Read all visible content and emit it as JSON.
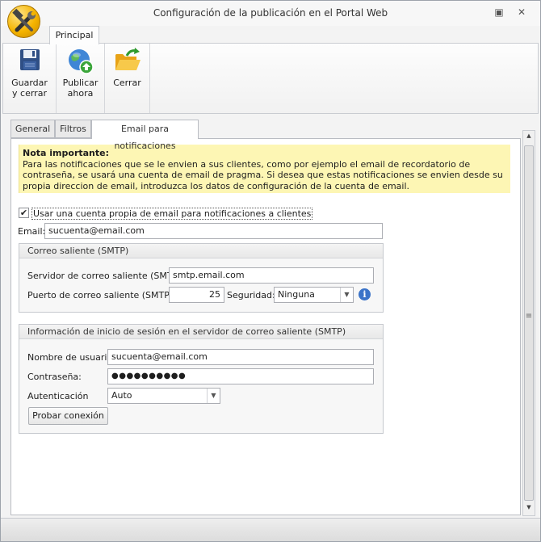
{
  "window": {
    "title": "Configuración de la publicación en el Portal Web",
    "restore_glyph": "▣",
    "close_glyph": "✕"
  },
  "ribbon": {
    "tab_label": "Principal",
    "buttons": [
      {
        "label": "Guardar\ny cerrar",
        "icon": "floppy-disk-icon"
      },
      {
        "label": "Publicar\nahora",
        "icon": "globe-upload-icon"
      },
      {
        "label": "Cerrar",
        "icon": "folder-icon"
      }
    ]
  },
  "tabs": [
    "General",
    "Filtros",
    "Email para notificaciones"
  ],
  "notice": {
    "heading": "Nota importante:",
    "body": "Para las notificaciones que se le envien a sus clientes, como por ejemplo el email de recordatorio de contraseña, se usará una cuenta de email de pragma. Si desea que estas notificaciones se envien desde su propia direccion de email, introduzca los datos de configuración de la cuenta de email."
  },
  "use_own_account": {
    "label": "Usar una cuenta propia de email para notificaciones a clientes",
    "checked_glyph": "✔"
  },
  "email": {
    "label": "Email:",
    "value": "sucuenta@email.com"
  },
  "smtp_group": {
    "title": "Correo saliente (SMTP)",
    "server_label": "Servidor de correo saliente (SMTP):",
    "server_value": "smtp.email.com",
    "port_label": "Puerto de correo saliente (SMTP):",
    "port_value": "25",
    "security_label": "Seguridad:",
    "security_value": "Ninguna",
    "info_glyph": "i"
  },
  "login_group": {
    "title": "Información de inicio de sesión en el servidor de correo saliente (SMTP)",
    "username_label": "Nombre de usuario:",
    "username_value": "sucuenta@email.com",
    "password_label": "Contraseña:",
    "password_value": "●●●●●●●●●●",
    "auth_label": "Autenticación",
    "auth_value": "Auto",
    "test_button": "Probar conexión"
  },
  "dropdown_arrow": "▼",
  "scroll_glyphs": {
    "up": "▲",
    "down": "▼",
    "grip": "≡"
  }
}
